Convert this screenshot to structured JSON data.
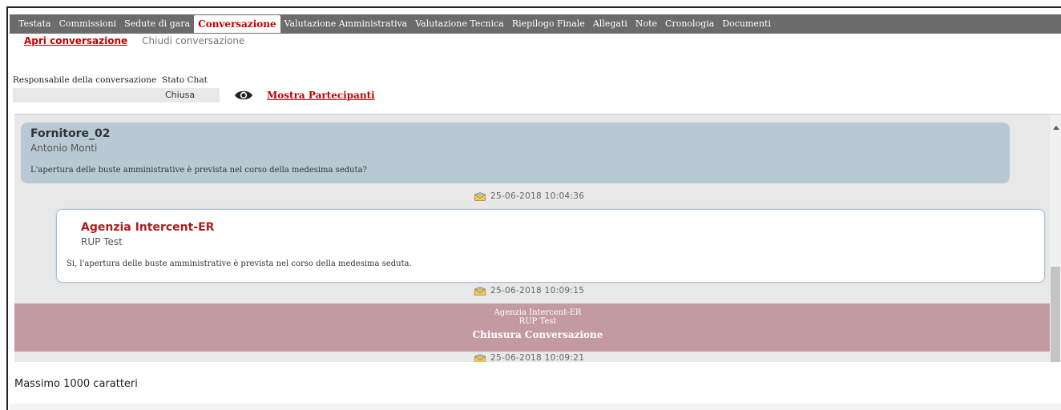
{
  "tabs": [
    {
      "label": "Testata",
      "active": false
    },
    {
      "label": "Commissioni",
      "active": false
    },
    {
      "label": "Sedute di gara",
      "active": false
    },
    {
      "label": "Conversazione",
      "active": true
    },
    {
      "label": "Valutazione Amministrativa",
      "active": false
    },
    {
      "label": "Valutazione Tecnica",
      "active": false
    },
    {
      "label": "Riepilogo Finale",
      "active": false
    },
    {
      "label": "Allegati",
      "active": false
    },
    {
      "label": "Note",
      "active": false
    },
    {
      "label": "Cronologia",
      "active": false
    },
    {
      "label": "Documenti",
      "active": false
    }
  ],
  "subtabs": {
    "open": "Apri conversazione",
    "close": "Chiudi conversazione"
  },
  "fields": {
    "responsabile_label": "Responsabile della conversazione",
    "responsabile_value": "",
    "stato_label": "Stato Chat",
    "stato_value": "Chiusa",
    "mostra_label": "Mostra Partecipanti"
  },
  "messages": [
    {
      "sender": "Fornitore_02",
      "user": "Antonio Monti",
      "text": "L'apertura delle buste amministrative è prevista nel corso della medesima seduta?",
      "timestamp": "25-06-2018 10:04:36"
    },
    {
      "sender": "Agenzia Intercent-ER",
      "user": "RUP Test",
      "text": "Si, l'apertura delle buste amministrative è prevista nel corso della medesima seduta.",
      "timestamp": "25-06-2018 10:09:15"
    }
  ],
  "closure": {
    "sender": "Agenzia Intercent-ER",
    "user": "RUP Test",
    "title": "Chiusura Conversazione",
    "timestamp": "25-06-2018 10:09:21"
  },
  "max_chars": "Massimo 1000 caratteri",
  "colors": {
    "accent": "#c00000",
    "tabbar": "#6b6b6b",
    "supplier_bubble": "#b8c9d3",
    "closure_bar": "#c49aa2"
  }
}
